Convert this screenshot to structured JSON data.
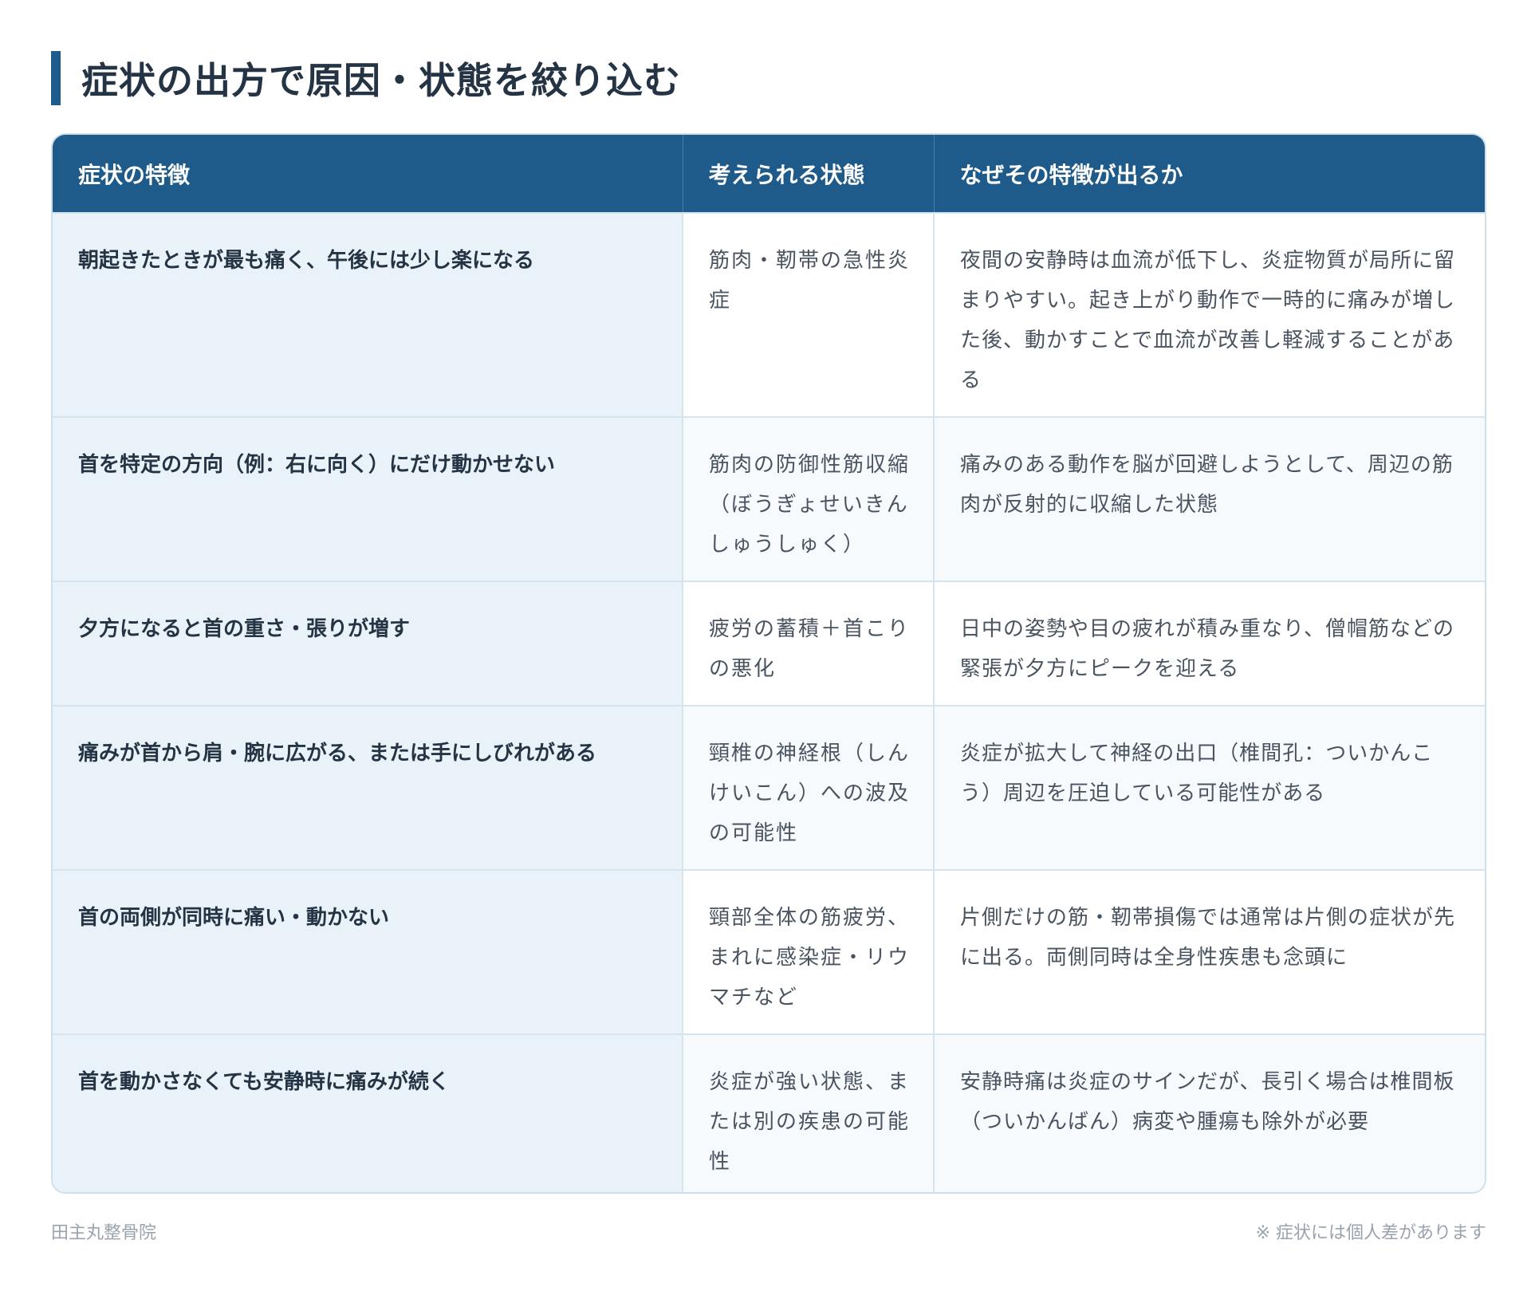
{
  "page": {
    "title": "症状の出方で原因・状態を絞り込む"
  },
  "table": {
    "headers": [
      "症状の特徴",
      "考えられる状態",
      "なぜその特徴が出るか"
    ],
    "rows": [
      {
        "symptom": "朝起きたときが最も痛く、午後には少し楽になる",
        "condition": "筋肉・靭帯の急性炎症",
        "reason": "夜間の安静時は血流が低下し、炎症物質が局所に留まりやすい。起き上がり動作で一時的に痛みが増した後、動かすことで血流が改善し軽減することがある"
      },
      {
        "symptom": "首を特定の方向（例：右に向く）にだけ動かせない",
        "condition": "筋肉の防御性筋収縮（ぼうぎょせいきんしゅうしゅく）",
        "reason": "痛みのある動作を脳が回避しようとして、周辺の筋肉が反射的に収縮した状態"
      },
      {
        "symptom": "夕方になると首の重さ・張りが増す",
        "condition": "疲労の蓄積＋首こりの悪化",
        "reason": "日中の姿勢や目の疲れが積み重なり、僧帽筋などの緊張が夕方にピークを迎える"
      },
      {
        "symptom": "痛みが首から肩・腕に広がる、または手にしびれがある",
        "condition": "頸椎の神経根（しんけいこん）への波及の可能性",
        "reason": "炎症が拡大して神経の出口（椎間孔：ついかんこう）周辺を圧迫している可能性がある"
      },
      {
        "symptom": "首の両側が同時に痛い・動かない",
        "condition": "頸部全体の筋疲労、まれに感染症・リウマチなど",
        "reason": "片側だけの筋・靭帯損傷では通常は片側の症状が先に出る。両側同時は全身性疾患も念頭に"
      },
      {
        "symptom": "首を動かさなくても安静時に痛みが続く",
        "condition": "炎症が強い状態、または別の疾患の可能性",
        "reason": "安静時痛は炎症のサインだが、長引く場合は椎間板（ついかんばん）病変や腫瘍も除外が必要"
      }
    ]
  },
  "footer": {
    "clinic": "田主丸整骨院",
    "note": "※ 症状には個人差があります"
  },
  "colors": {
    "accent": "#1e5a8a",
    "symptom_bg": "#eaf2f9",
    "border": "#d6e4ee"
  }
}
